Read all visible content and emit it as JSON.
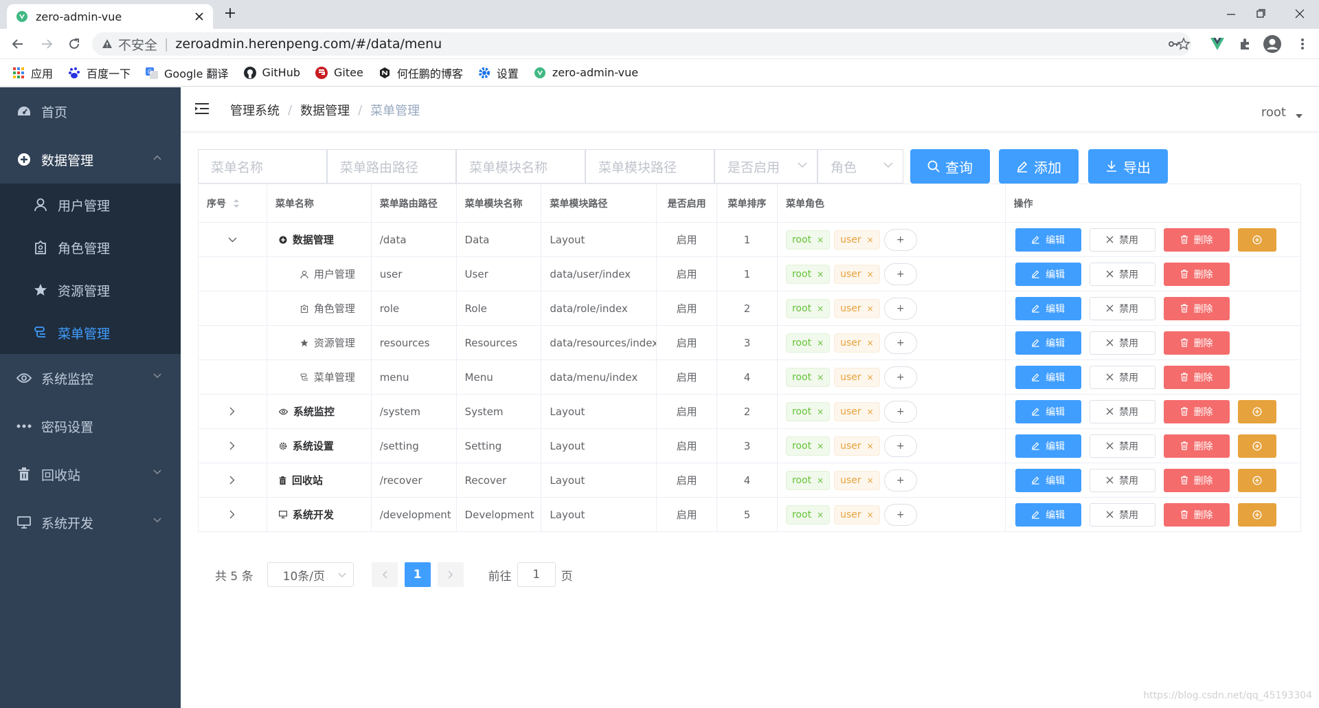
{
  "browser": {
    "tab_title": "zero-admin-vue",
    "insecure_label": "不安全",
    "url": "zeroadmin.herenpeng.com/#/data/menu"
  },
  "bookmarks": [
    {
      "label": "应用",
      "icon": "apps-grid-icon"
    },
    {
      "label": "百度一下",
      "icon": "baidu-paw-icon"
    },
    {
      "label": "Google 翻译",
      "icon": "google-translate-icon"
    },
    {
      "label": "GitHub",
      "icon": "github-icon"
    },
    {
      "label": "Gitee",
      "icon": "gitee-icon"
    },
    {
      "label": "何任鹏的博客",
      "icon": "blog-icon"
    },
    {
      "label": "设置",
      "icon": "gear-icon"
    },
    {
      "label": "zero-admin-vue",
      "icon": "vue-icon"
    }
  ],
  "sidebar": {
    "home": "首页",
    "data_mgmt": "数据管理",
    "sub": [
      "用户管理",
      "角色管理",
      "资源管理",
      "菜单管理"
    ],
    "monitor": "系统监控",
    "password": "密码设置",
    "recycle": "回收站",
    "dev": "系统开发"
  },
  "breadcrumb": [
    "管理系统",
    "数据管理",
    "菜单管理"
  ],
  "user": "root",
  "filter": {
    "menu_name": "菜单名称",
    "route_path": "菜单路由路径",
    "module_name": "菜单模块名称",
    "module_path": "菜单模块路径",
    "enabled": "是否启用",
    "role": "角色",
    "query": "查询",
    "add": "添加",
    "export": "导出"
  },
  "table": {
    "headers": [
      "序号",
      "菜单名称",
      "菜单路由路径",
      "菜单模块名称",
      "菜单模块路径",
      "是否启用",
      "菜单排序",
      "菜单角色",
      "操作"
    ],
    "rows": [
      {
        "expand": "down",
        "icon": "plus-circle-icon",
        "name": "数据管理",
        "path": "/data",
        "module": "Data",
        "mpath": "Layout",
        "enabled": "启用",
        "sort": "1",
        "child": false,
        "add": true
      },
      {
        "expand": "",
        "icon": "user-icon",
        "name": "用户管理",
        "path": "user",
        "module": "User",
        "mpath": "data/user/index",
        "enabled": "启用",
        "sort": "1",
        "child": true,
        "add": false
      },
      {
        "expand": "",
        "icon": "badge-icon",
        "name": "角色管理",
        "path": "role",
        "module": "Role",
        "mpath": "data/role/index",
        "enabled": "启用",
        "sort": "2",
        "child": true,
        "add": false
      },
      {
        "expand": "",
        "icon": "star-icon",
        "name": "资源管理",
        "path": "resources",
        "module": "Resources",
        "mpath": "data/resources/index",
        "enabled": "启用",
        "sort": "3",
        "child": true,
        "add": false
      },
      {
        "expand": "",
        "icon": "menu-icon",
        "name": "菜单管理",
        "path": "menu",
        "module": "Menu",
        "mpath": "data/menu/index",
        "enabled": "启用",
        "sort": "4",
        "child": true,
        "add": false
      },
      {
        "expand": "right",
        "icon": "eye-icon",
        "name": "系统监控",
        "path": "/system",
        "module": "System",
        "mpath": "Layout",
        "enabled": "启用",
        "sort": "2",
        "child": false,
        "add": true
      },
      {
        "expand": "right",
        "icon": "gear-icon",
        "name": "系统设置",
        "path": "/setting",
        "module": "Setting",
        "mpath": "Layout",
        "enabled": "启用",
        "sort": "3",
        "child": false,
        "add": true
      },
      {
        "expand": "right",
        "icon": "trash-icon",
        "name": "回收站",
        "path": "/recover",
        "module": "Recover",
        "mpath": "Layout",
        "enabled": "启用",
        "sort": "4",
        "child": false,
        "add": true
      },
      {
        "expand": "right",
        "icon": "monitor-icon",
        "name": "系统开发",
        "path": "/development",
        "module": "Development",
        "mpath": "Layout",
        "enabled": "启用",
        "sort": "5",
        "child": false,
        "add": true
      }
    ],
    "tag_root": "root",
    "tag_user": "user",
    "tag_plus": "+",
    "btn_edit": "编辑",
    "btn_disable": "禁用",
    "btn_delete": "删除"
  },
  "pagination": {
    "total": "共 5 条",
    "page_size": "10条/页",
    "current": "1",
    "goto": "前往",
    "goto_value": "1",
    "page_unit": "页"
  },
  "watermark": "https://blog.csdn.net/qq_45193304",
  "colors": {
    "primary": "#409eff",
    "sidebar": "#304156",
    "danger": "#f56c6c",
    "warning": "#e6a23c"
  }
}
